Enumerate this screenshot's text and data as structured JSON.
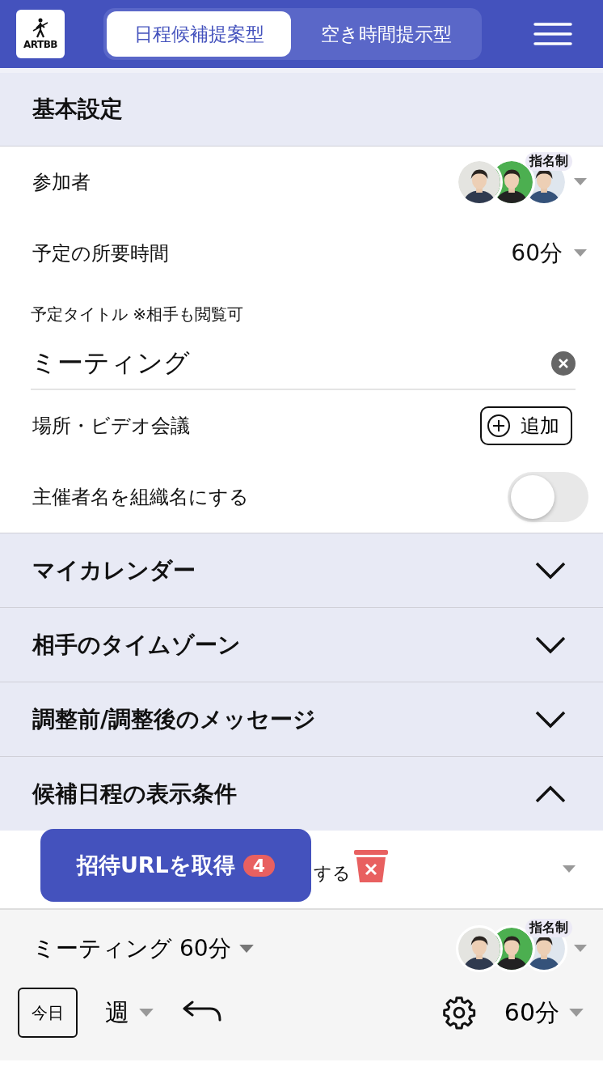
{
  "header": {
    "logo_text": "ARTBB",
    "tabs": [
      {
        "label": "日程候補提案型",
        "selected": true
      },
      {
        "label": "空き時間提示型",
        "selected": false
      }
    ]
  },
  "basic_settings": {
    "title": "基本設定",
    "participants": {
      "label": "参加者",
      "badge": "指名制"
    },
    "duration": {
      "label": "予定の所要時間",
      "value": "60分"
    },
    "title_field": {
      "label": "予定タイトル ※相手も閲覧可",
      "value": "ミーティング"
    },
    "location": {
      "label": "場所・ビデオ会議",
      "button": "追加"
    },
    "organizer_toggle": {
      "label": "主催者名を組織名にする",
      "on": false
    }
  },
  "sections": [
    {
      "title": "マイカレンダー",
      "expanded": false
    },
    {
      "title": "相手のタイムゾーン",
      "expanded": false
    },
    {
      "title": "調整前/調整後のメッセージ",
      "expanded": false
    },
    {
      "title": "候補日程の表示条件",
      "expanded": true
    }
  ],
  "condition_row": {
    "visible_text": "する"
  },
  "invite_button": {
    "label": "招待URLを取得",
    "badge": "4"
  },
  "footer": {
    "event_label": "ミーティング 60分",
    "badge": "指名制",
    "today": "今日",
    "view": "週",
    "duration": "60分"
  }
}
